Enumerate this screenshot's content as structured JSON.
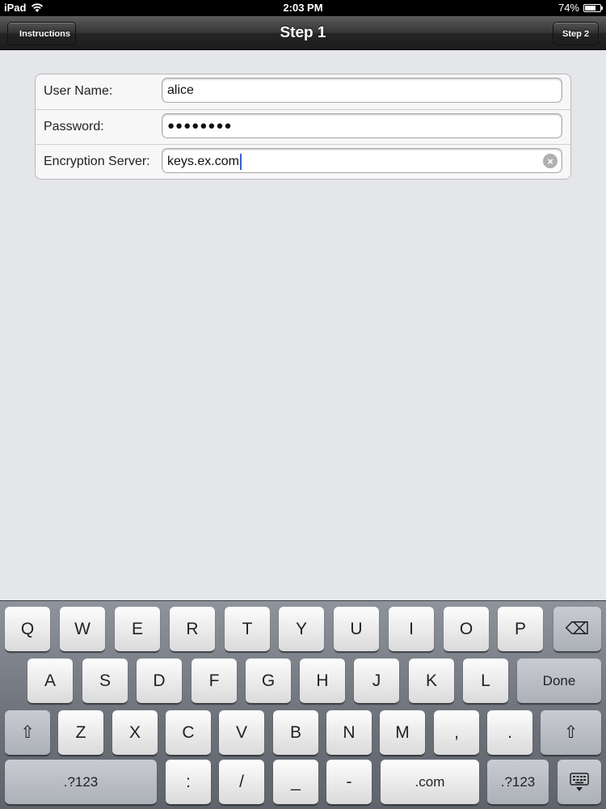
{
  "status_bar": {
    "device": "iPad",
    "time": "2:03 PM",
    "battery": "74%",
    "battery_level": 0.74,
    "wifi_icon": "wifi-icon"
  },
  "nav": {
    "back_label": "Instructions",
    "title": "Step 1",
    "next_label": "Step 2"
  },
  "form": {
    "username_label": "User Name:",
    "username_value": "alice",
    "password_label": "Password:",
    "password_value": "●●●●●●●●",
    "server_label": "Encryption Server:",
    "server_value": "keys.ex.com",
    "clear_icon": "clear-icon"
  },
  "keyboard": {
    "row1": [
      "Q",
      "W",
      "E",
      "R",
      "T",
      "Y",
      "U",
      "I",
      "O",
      "P"
    ],
    "delete_key": "⌫",
    "row2": [
      "A",
      "S",
      "D",
      "F",
      "G",
      "H",
      "J",
      "K",
      "L"
    ],
    "done_key": "Done",
    "shift_key": "⇧",
    "row3": [
      "Z",
      "X",
      "C",
      "V",
      "B",
      "N",
      "M",
      ",",
      "."
    ],
    "numbers_key": ".?123",
    "row4": [
      ":",
      "/",
      "_",
      "-",
      ".com"
    ],
    "hide_keyboard_icon": "keyboard-hide-icon"
  }
}
